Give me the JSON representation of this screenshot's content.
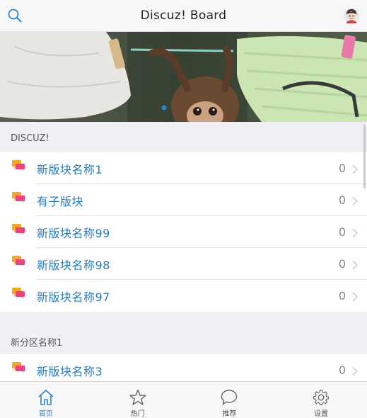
{
  "header": {
    "title": "Discuz! Board"
  },
  "banner": {
    "slides": 2,
    "active_slide": 0
  },
  "sections": [
    {
      "title": "DISCUZ!",
      "forums": [
        {
          "name": "新版块名称1",
          "count": "0"
        },
        {
          "name": "有子版块",
          "count": "0"
        },
        {
          "name": "新版块名称99",
          "count": "0"
        },
        {
          "name": "新版块名称98",
          "count": "0"
        },
        {
          "name": "新版块名称97",
          "count": "0"
        }
      ]
    },
    {
      "title": "新分区名称1",
      "forums": [
        {
          "name": "新版块名称3",
          "count": "0"
        }
      ]
    }
  ],
  "tabbar": {
    "tabs": [
      {
        "label": "首页",
        "icon": "home-icon",
        "active": true
      },
      {
        "label": "热门",
        "icon": "star-icon",
        "active": false
      },
      {
        "label": "推荐",
        "icon": "chat-bubble-icon",
        "active": false
      },
      {
        "label": "设置",
        "icon": "gear-icon",
        "active": false
      }
    ]
  },
  "colors": {
    "accent": "#2a86d6",
    "forum_name": "#2a7bb8",
    "icon_orange": "#f5a623",
    "icon_pink": "#e8457d"
  }
}
